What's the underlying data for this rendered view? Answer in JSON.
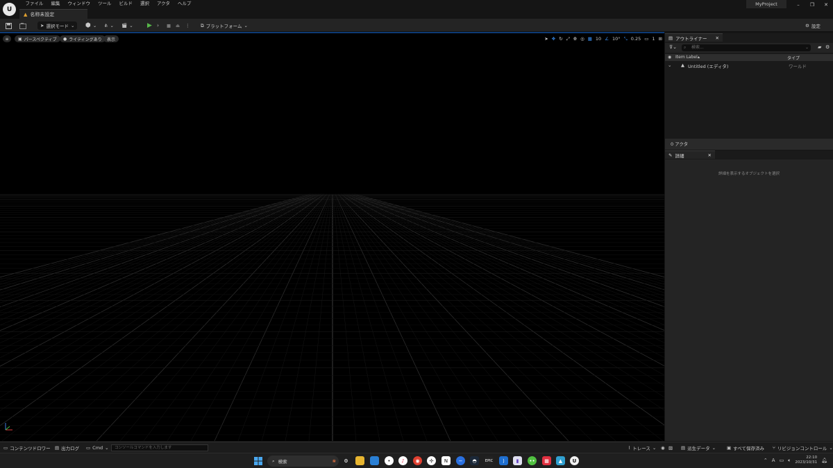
{
  "menu": [
    "ファイル",
    "編集",
    "ウィンドウ",
    "ツール",
    "ビルド",
    "選択",
    "アクタ",
    "ヘルプ"
  ],
  "document_tab": "名称未設定",
  "project_name": "MyProject",
  "toolbar": {
    "mode_label": "選択モード",
    "platform_label": "プラットフォーム",
    "settings_label": "設定"
  },
  "viewport": {
    "perspective_label": "パースペクティブ",
    "lighting_label": "ライティングあり",
    "show_label": "表示",
    "grid_snap": "10",
    "rotation_snap": "10°",
    "scale_snap": "0.25",
    "camera_speed": "1"
  },
  "outliner": {
    "tab_label": "アウトライナー",
    "search_placeholder": "検索...",
    "col_label": "Item Label",
    "col_type": "タイプ",
    "row_label": "Untitled (エディタ)",
    "row_type": "ワールド",
    "actor_count": "0 アクタ"
  },
  "details": {
    "tab_label": "詳細",
    "hint": "詳細を表示するオブジェクトを選択"
  },
  "statusbar": {
    "content_drawer": "コンテンツドロワー",
    "output_log": "出力ログ",
    "cmd": "Cmd",
    "console_placeholder": "コンソールコマンドを入力します",
    "trace": "トレース",
    "derived_data": "派生データ",
    "save_all": "すべて保存済み",
    "revision_control": "リビジョンコントロール"
  },
  "taskbar": {
    "search_label": "検索",
    "time": "22:10",
    "date": "2023/10/31",
    "ime": "A"
  },
  "colors": {
    "accent_blue": "#0d3a75",
    "play_green": "#58b84a"
  }
}
